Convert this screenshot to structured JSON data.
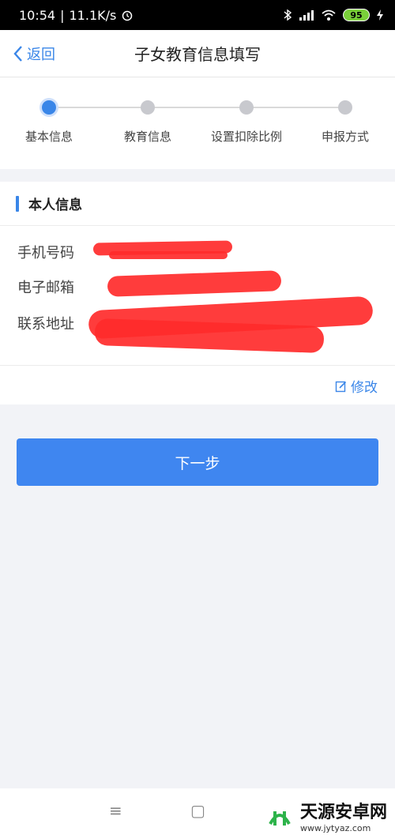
{
  "status_bar": {
    "time": "10:54",
    "speed": "11.1K/s",
    "battery": "95",
    "icons": [
      "alarm-icon",
      "bluetooth-icon",
      "signal-icon",
      "wifi-icon",
      "battery-icon",
      "charging-icon"
    ]
  },
  "nav": {
    "back_label": "返回",
    "title": "子女教育信息填写"
  },
  "stepper": {
    "steps": [
      {
        "label": "基本信息",
        "active": true
      },
      {
        "label": "教育信息",
        "active": false
      },
      {
        "label": "设置扣除比例",
        "active": false
      },
      {
        "label": "申报方式",
        "active": false
      }
    ]
  },
  "personal_info": {
    "section_title": "本人信息",
    "phone_label": "手机号码",
    "email_label": "电子邮箱",
    "address_label": "联系地址",
    "edit_label": "修改"
  },
  "actions": {
    "next_label": "下一步"
  },
  "system_nav": {
    "menu_glyph": "≡",
    "home_glyph": "▢"
  },
  "watermark": {
    "name": "天源安卓网",
    "url": "www.jytyaz.com"
  },
  "colors": {
    "accent": "#3a86e8",
    "button": "#3f86f0",
    "redaction": "#ff2b2b"
  }
}
